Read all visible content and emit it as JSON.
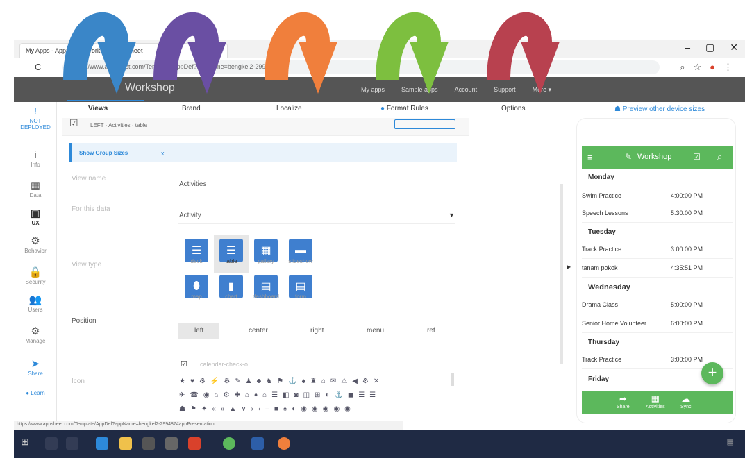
{
  "browser": {
    "tab_title": "My Apps - AppSheet: Workshop AppSheet",
    "url": "https://www.appsheet.com/Template/AppDef?appName=bengkel2-299487",
    "window_controls": [
      "–",
      "▢",
      "✕"
    ]
  },
  "app_header": {
    "app_name": "Workshop",
    "menu": [
      "My apps",
      "Sample apps",
      "Account",
      "Support",
      "More ▾"
    ]
  },
  "tabs": [
    "Views",
    "Brand",
    "Localize",
    "Format Rules",
    "Options"
  ],
  "preview_link": "Preview other device sizes",
  "sidebar": [
    {
      "label": "NOT DEPLOYED",
      "icon": "!"
    },
    {
      "label": "Info",
      "icon": "i"
    },
    {
      "label": "Data",
      "icon": "▦"
    },
    {
      "label": "UX",
      "icon": "▣"
    },
    {
      "label": "Behavior",
      "icon": "⚙"
    },
    {
      "label": "Security",
      "icon": "🔒"
    },
    {
      "label": "Users",
      "icon": "👥"
    },
    {
      "label": "Manage",
      "icon": "⚙"
    },
    {
      "label": "Share",
      "icon": "➤"
    },
    {
      "label": "Learn",
      "icon": "●"
    }
  ],
  "form": {
    "subheader": "LEFT · Activities · table",
    "banner": "Show Group Sizes",
    "banner_close": "x",
    "view_name_label": "View name",
    "view_name_value": "Activities",
    "for_this_data_label": "For this data",
    "for_this_data_value": "Activity",
    "view_type_label": "View type",
    "view_types": [
      "deck",
      "table",
      "gallery",
      "slideshow",
      "map",
      "chart",
      "dashboard",
      "form"
    ],
    "position_label": "Position",
    "positions": [
      "left",
      "center",
      "right",
      "menu",
      "ref"
    ],
    "icon_label": "Icon",
    "icon_value": "calendar-check-o"
  },
  "phone": {
    "title": "Workshop",
    "days": [
      {
        "day": "Monday",
        "events": [
          {
            "name": "Swim Practice",
            "time": "4:00:00 PM"
          },
          {
            "name": "Speech Lessons",
            "time": "5:30:00 PM"
          }
        ]
      },
      {
        "day": "Tuesday",
        "events": [
          {
            "name": "Track Practice",
            "time": "3:00:00 PM"
          },
          {
            "name": "tanam pokok",
            "time": "4:35:51 PM"
          }
        ]
      },
      {
        "day": "Wednesday",
        "events": [
          {
            "name": "Drama Class",
            "time": "5:00:00 PM"
          },
          {
            "name": "Senior Home Volunteer",
            "time": "6:00:00 PM"
          }
        ]
      },
      {
        "day": "Thursday",
        "events": [
          {
            "name": "Track Practice",
            "time": "3:00:00 PM"
          }
        ]
      },
      {
        "day": "Friday",
        "events": []
      }
    ],
    "bottom_nav": [
      "Share",
      "Activities",
      "Sync"
    ],
    "fab": "+"
  },
  "status_url": "https://www.appsheet.com/Template/AppDef?appName=bengkel2-299487#appPresentation",
  "colors": {
    "accent": "#2d89d9",
    "phone_green": "#5cb85c",
    "arrow_colors": [
      "#3a86c8",
      "#6a4fa3",
      "#f07f3c",
      "#7dbf3f",
      "#b8414f"
    ]
  }
}
